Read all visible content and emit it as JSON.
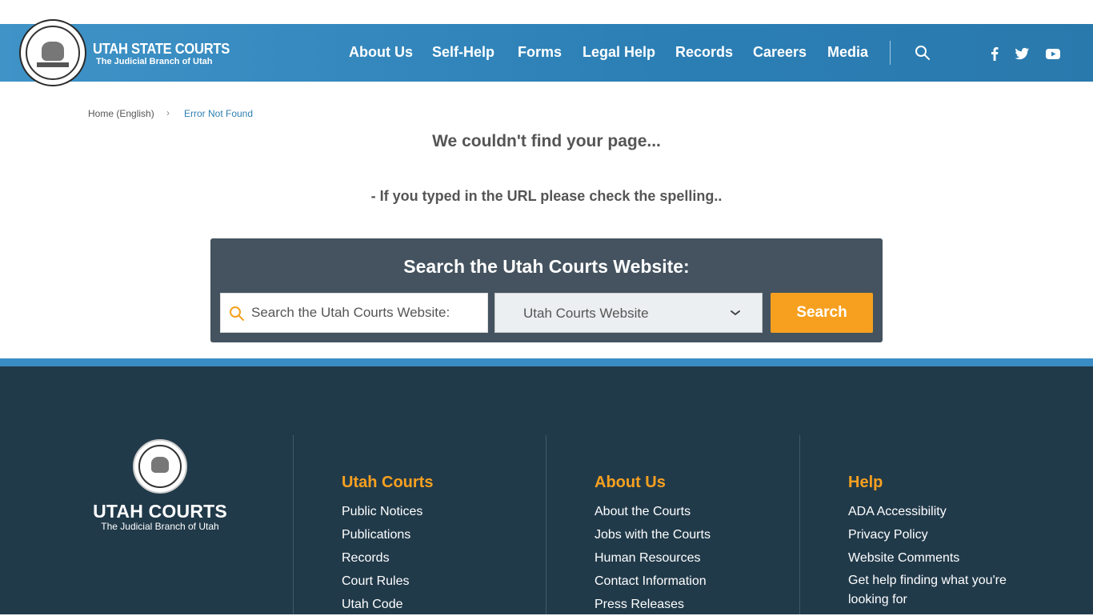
{
  "header": {
    "brand_title": "UTAH STATE COURTS",
    "brand_subtitle": "The Judicial Branch of Utah",
    "nav": [
      "About Us",
      "Self-Help",
      "Forms",
      "Legal Help",
      "Records",
      "Careers",
      "Media"
    ],
    "icons": [
      "search-icon",
      "facebook-icon",
      "twitter-icon",
      "youtube-icon"
    ]
  },
  "breadcrumb": {
    "home": "Home (English)",
    "current": "Error Not Found"
  },
  "main": {
    "title": "We couldn't find your page...",
    "hint": "- If you typed in the URL please check the spelling.."
  },
  "search": {
    "title": "Search the Utah Courts Website:",
    "placeholder": "Search the Utah Courts Website:",
    "scope_selected": "Utah Courts Website",
    "button": "Search"
  },
  "footer": {
    "brand_title": "UTAH COURTS",
    "brand_subtitle": "The Judicial Branch of Utah",
    "columns": [
      {
        "heading": "Utah Courts",
        "links": [
          "Public Notices",
          "Publications",
          "Records",
          "Court Rules",
          "Utah Code"
        ]
      },
      {
        "heading": "About Us",
        "links": [
          "About the Courts",
          "Jobs with the Courts",
          "Human Resources",
          "Contact Information",
          "Press Releases"
        ]
      },
      {
        "heading": "Help",
        "links": [
          "ADA Accessibility",
          "Privacy Policy",
          "Website Comments",
          "Get help finding what you're looking for"
        ]
      }
    ]
  },
  "colors": {
    "header_blue": "#2b7fb5",
    "accent_orange": "#f7a01f",
    "footer_navy": "#213a4a",
    "search_panel": "#44535f"
  }
}
